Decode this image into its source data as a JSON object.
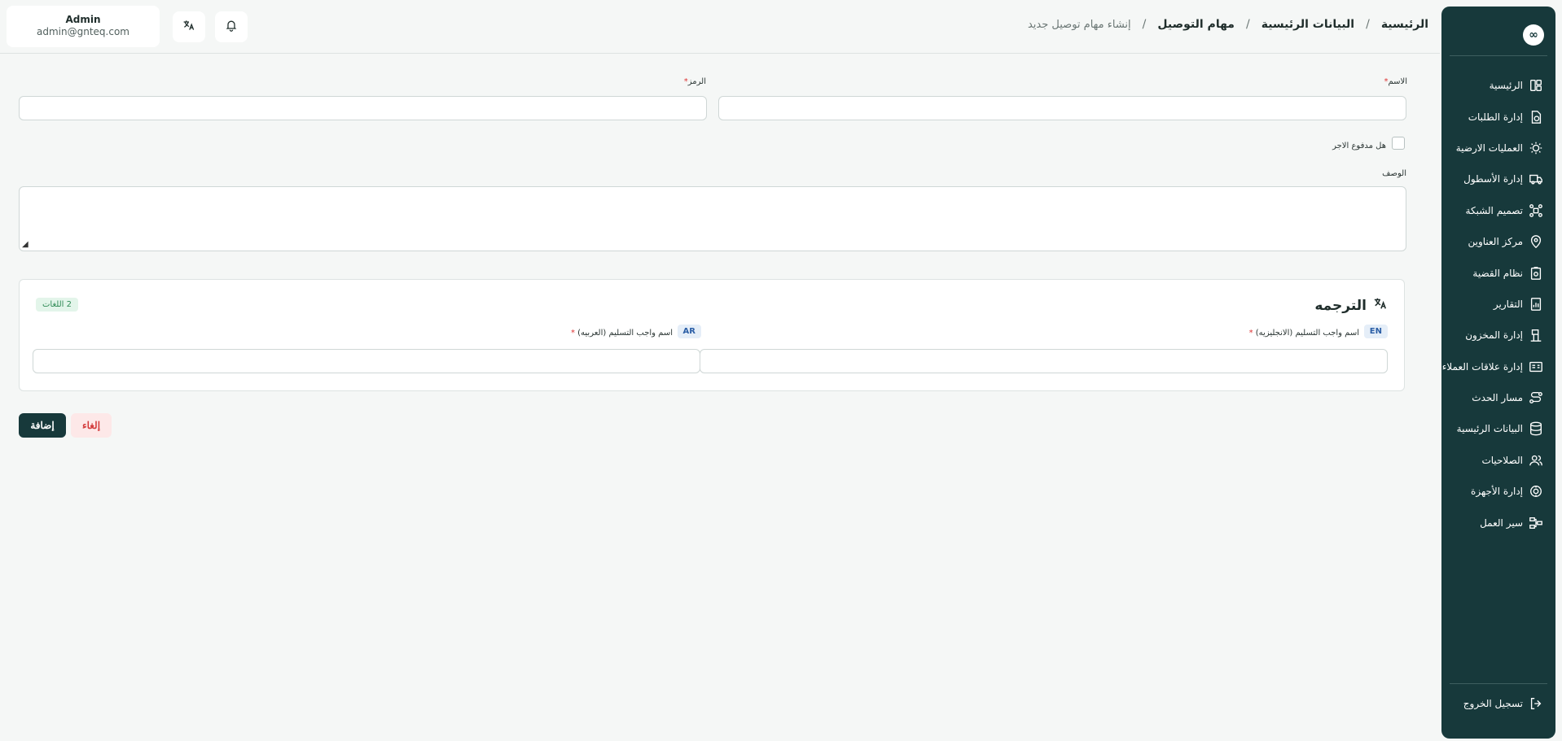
{
  "header": {
    "breadcrumb": {
      "home": "الرئيسية",
      "master_data": "البيانات الرئيسية",
      "delivery_tasks": "مهام التوصيل",
      "current": "إنشاء مهام توصيل جديد",
      "separator": "/"
    },
    "user": {
      "name": "Admin",
      "email": "admin@gnteq.com"
    },
    "buttons": {
      "translate_icon": "translate-icon",
      "notifications_icon": "bell-icon"
    }
  },
  "sidebar": {
    "logo_glyph": "∞",
    "items": [
      {
        "label": "الرئيسية",
        "icon": "dashboard-icon"
      },
      {
        "label": "إدارة الطلبات",
        "icon": "orders-icon"
      },
      {
        "label": "العمليات الارضية",
        "icon": "ground-ops-icon"
      },
      {
        "label": "إدارة الأسطول",
        "icon": "truck-icon"
      },
      {
        "label": "تصميم الشبكة",
        "icon": "network-icon"
      },
      {
        "label": "مركز العناوين",
        "icon": "location-icon"
      },
      {
        "label": "نظام القضية",
        "icon": "case-icon"
      },
      {
        "label": "التقارير",
        "icon": "reports-icon"
      },
      {
        "label": "إدارة المخزون",
        "icon": "inventory-icon"
      },
      {
        "label": "إدارة علاقات العملاء",
        "icon": "crm-icon"
      },
      {
        "label": "مسار الحدث",
        "icon": "route-icon"
      },
      {
        "label": "البيانات الرئيسية",
        "icon": "database-icon"
      },
      {
        "label": "الصلاحيات",
        "icon": "users-icon"
      },
      {
        "label": "إدارة الأجهزة",
        "icon": "devices-icon"
      },
      {
        "label": "سير العمل",
        "icon": "workflow-icon"
      }
    ],
    "logout": {
      "label": "تسجيل الخروج",
      "icon": "logout-icon"
    }
  },
  "form": {
    "name": {
      "label": "الاسم",
      "required_mark": "*",
      "value": ""
    },
    "code": {
      "label": "الرمز",
      "required_mark": "*",
      "value": ""
    },
    "is_paid": {
      "label": "هل مدفوع الاجر",
      "checked": false
    },
    "description": {
      "label": "الوصف",
      "value": ""
    },
    "translation": {
      "title": "الترجمه",
      "languages_count": "2 اللغات",
      "en": {
        "badge": "EN",
        "label": "اسم واجب التسليم (الانجليزيه)",
        "required_mark": "*",
        "value": ""
      },
      "ar": {
        "badge": "AR",
        "label": "اسم واجب التسليم (العربيه)",
        "required_mark": "*",
        "value": ""
      }
    },
    "actions": {
      "add": "إضافة",
      "cancel": "إلغاء"
    }
  },
  "colors": {
    "sidebar_bg": "#17393b",
    "primary_button": "#17393b",
    "cancel_bg": "#fde8e8",
    "cancel_text": "#d33a3a",
    "required": "#d33333",
    "lang_count_bg": "#e3f5ea",
    "lang_badge_bg": "#e5eef8"
  }
}
